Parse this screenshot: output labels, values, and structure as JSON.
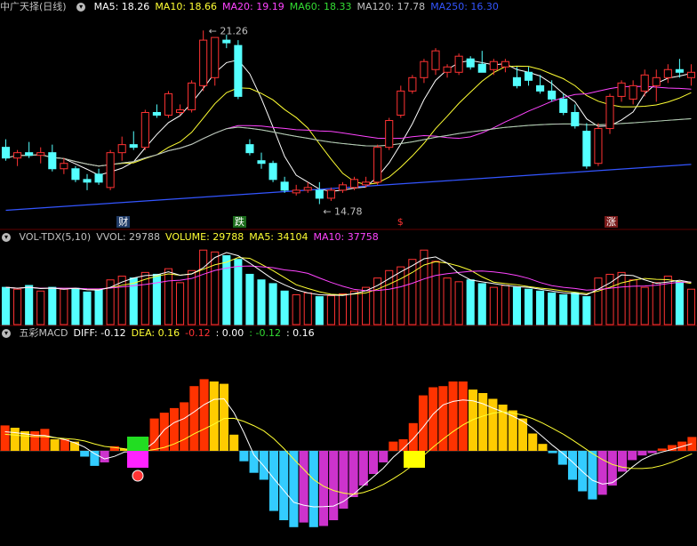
{
  "main_panel": {
    "title": "中广天择(日线)",
    "ma": [
      {
        "label": "MA5: 18.26",
        "color": "#ffffff"
      },
      {
        "label": "MA10: 18.66",
        "color": "#ffff33"
      },
      {
        "label": "MA20: 19.19",
        "color": "#ff44ff"
      },
      {
        "label": "MA60: 18.33",
        "color": "#33dd33"
      },
      {
        "label": "MA120: 17.78",
        "color": "#c0c0c0"
      },
      {
        "label": "MA250: 16.30",
        "color": "#3355ff"
      }
    ],
    "high_label": "21.26",
    "low_label": "14.78",
    "markers": [
      {
        "text": "财",
        "color": "#ffffff",
        "bg": "#1f3a66"
      },
      {
        "text": "跌",
        "color": "#ffffff",
        "bg": "#1a6a1a"
      },
      {
        "text": "$",
        "color": "#ff3333",
        "bg": ""
      },
      {
        "text": "涨",
        "color": "#ffffff",
        "bg": "#7a1a1a"
      }
    ]
  },
  "vol_panel": {
    "items": [
      {
        "label": "VOL-TDX(5,10)",
        "color": "#c0c0c0"
      },
      {
        "label": "VVOL: 29788",
        "color": "#c0c0c0"
      },
      {
        "label": "VOLUME: 29788",
        "color": "#ffff33"
      },
      {
        "label": "MA5: 34104",
        "color": "#ffff33"
      },
      {
        "label": "MA10: 37758",
        "color": "#ff44ff"
      }
    ]
  },
  "macd_panel": {
    "items": [
      {
        "label": "五彩MACD",
        "color": "#c0c0c0"
      },
      {
        "label": "DIFF: -0.12",
        "color": "#ffffff"
      },
      {
        "label": "DEA: 0.16",
        "color": "#ffff33"
      },
      {
        "label": "-0.12",
        "color": "#ff3333"
      },
      {
        "label": ": 0.00",
        "color": "#ffffff"
      },
      {
        "label": ": -0.12",
        "color": "#33dd33"
      },
      {
        "label": ": 0.16",
        "color": "#ffffff"
      }
    ]
  },
  "chart_data": {
    "type": "candlestick",
    "candles": [
      {
        "o": 16.9,
        "h": 17.2,
        "l": 16.4,
        "c": 16.5
      },
      {
        "o": 16.5,
        "h": 16.8,
        "l": 16.2,
        "c": 16.7
      },
      {
        "o": 16.7,
        "h": 17.1,
        "l": 16.5,
        "c": 16.6
      },
      {
        "o": 16.6,
        "h": 16.9,
        "l": 16.3,
        "c": 16.7
      },
      {
        "o": 16.7,
        "h": 17.0,
        "l": 16.0,
        "c": 16.1
      },
      {
        "o": 16.1,
        "h": 16.5,
        "l": 15.9,
        "c": 16.3
      },
      {
        "o": 16.1,
        "h": 16.2,
        "l": 15.6,
        "c": 15.7
      },
      {
        "o": 15.7,
        "h": 15.9,
        "l": 15.3,
        "c": 15.6
      },
      {
        "o": 15.9,
        "h": 16.1,
        "l": 15.5,
        "c": 15.6
      },
      {
        "o": 15.4,
        "h": 16.8,
        "l": 15.3,
        "c": 16.7
      },
      {
        "o": 16.7,
        "h": 17.3,
        "l": 16.4,
        "c": 17.0
      },
      {
        "o": 17.0,
        "h": 17.5,
        "l": 16.8,
        "c": 16.9
      },
      {
        "o": 16.9,
        "h": 18.3,
        "l": 16.8,
        "c": 18.2
      },
      {
        "o": 18.2,
        "h": 18.5,
        "l": 18.0,
        "c": 18.1
      },
      {
        "o": 18.1,
        "h": 19.0,
        "l": 18.0,
        "c": 18.9
      },
      {
        "o": 18.2,
        "h": 18.5,
        "l": 18.1,
        "c": 18.3
      },
      {
        "o": 18.3,
        "h": 19.4,
        "l": 18.2,
        "c": 19.3
      },
      {
        "o": 19.2,
        "h": 21.26,
        "l": 19.0,
        "c": 20.9
      },
      {
        "o": 19.5,
        "h": 21.0,
        "l": 19.2,
        "c": 21.0
      },
      {
        "o": 20.9,
        "h": 21.1,
        "l": 20.6,
        "c": 20.8
      },
      {
        "o": 20.7,
        "h": 20.9,
        "l": 18.7,
        "c": 18.8
      },
      {
        "o": 17.0,
        "h": 17.2,
        "l": 16.6,
        "c": 16.7
      },
      {
        "o": 16.4,
        "h": 16.7,
        "l": 16.1,
        "c": 16.3
      },
      {
        "o": 16.3,
        "h": 16.4,
        "l": 15.6,
        "c": 15.7
      },
      {
        "o": 15.6,
        "h": 15.8,
        "l": 15.2,
        "c": 15.3
      },
      {
        "o": 15.2,
        "h": 15.5,
        "l": 15.1,
        "c": 15.3
      },
      {
        "o": 15.3,
        "h": 15.6,
        "l": 15.2,
        "c": 15.4
      },
      {
        "o": 15.3,
        "h": 15.6,
        "l": 14.78,
        "c": 15.0
      },
      {
        "o": 15.0,
        "h": 15.4,
        "l": 14.9,
        "c": 15.3
      },
      {
        "o": 15.3,
        "h": 15.6,
        "l": 15.2,
        "c": 15.5
      },
      {
        "o": 15.4,
        "h": 15.8,
        "l": 15.3,
        "c": 15.7
      },
      {
        "o": 15.5,
        "h": 15.8,
        "l": 15.4,
        "c": 15.6
      },
      {
        "o": 15.6,
        "h": 17.0,
        "l": 15.5,
        "c": 16.9
      },
      {
        "o": 16.9,
        "h": 18.0,
        "l": 16.8,
        "c": 17.9
      },
      {
        "o": 18.1,
        "h": 19.2,
        "l": 18.0,
        "c": 19.0
      },
      {
        "o": 19.0,
        "h": 19.6,
        "l": 18.9,
        "c": 19.5
      },
      {
        "o": 19.5,
        "h": 20.2,
        "l": 19.3,
        "c": 20.1
      },
      {
        "o": 19.8,
        "h": 20.6,
        "l": 19.6,
        "c": 20.5
      },
      {
        "o": 19.7,
        "h": 20.0,
        "l": 19.5,
        "c": 19.9
      },
      {
        "o": 19.7,
        "h": 20.4,
        "l": 19.6,
        "c": 20.3
      },
      {
        "o": 20.2,
        "h": 20.3,
        "l": 19.8,
        "c": 19.9
      },
      {
        "o": 20.0,
        "h": 20.5,
        "l": 19.8,
        "c": 19.7
      },
      {
        "o": 19.8,
        "h": 20.2,
        "l": 19.6,
        "c": 20.1
      },
      {
        "o": 19.9,
        "h": 20.2,
        "l": 19.7,
        "c": 20.1
      },
      {
        "o": 19.5,
        "h": 19.9,
        "l": 19.1,
        "c": 19.2
      },
      {
        "o": 19.7,
        "h": 19.9,
        "l": 19.2,
        "c": 19.4
      },
      {
        "o": 19.2,
        "h": 19.6,
        "l": 18.9,
        "c": 19.0
      },
      {
        "o": 19.0,
        "h": 19.4,
        "l": 18.6,
        "c": 18.7
      },
      {
        "o": 18.7,
        "h": 18.9,
        "l": 18.1,
        "c": 18.2
      },
      {
        "o": 18.2,
        "h": 18.5,
        "l": 17.6,
        "c": 17.7
      },
      {
        "o": 17.5,
        "h": 17.8,
        "l": 16.1,
        "c": 16.2
      },
      {
        "o": 16.3,
        "h": 17.8,
        "l": 16.2,
        "c": 17.6
      },
      {
        "o": 17.6,
        "h": 18.9,
        "l": 17.4,
        "c": 18.8
      },
      {
        "o": 18.8,
        "h": 19.4,
        "l": 18.6,
        "c": 19.3
      },
      {
        "o": 18.7,
        "h": 19.4,
        "l": 18.5,
        "c": 19.2
      },
      {
        "o": 19.0,
        "h": 19.8,
        "l": 18.8,
        "c": 19.6
      },
      {
        "o": 19.2,
        "h": 19.8,
        "l": 18.6,
        "c": 19.5
      },
      {
        "o": 19.5,
        "h": 20.0,
        "l": 19.3,
        "c": 19.8
      },
      {
        "o": 19.8,
        "h": 20.2,
        "l": 19.5,
        "c": 19.7
      },
      {
        "o": 19.5,
        "h": 20.0,
        "l": 19.2,
        "c": 19.7
      }
    ],
    "volumes": [
      40,
      38,
      42,
      36,
      40,
      38,
      39,
      35,
      37,
      48,
      52,
      50,
      56,
      54,
      60,
      45,
      58,
      80,
      78,
      74,
      70,
      54,
      48,
      44,
      36,
      32,
      34,
      30,
      31,
      33,
      36,
      40,
      50,
      58,
      62,
      70,
      80,
      68,
      50,
      46,
      48,
      44,
      40,
      42,
      40,
      38,
      36,
      34,
      32,
      34,
      30,
      50,
      54,
      56,
      48,
      40,
      45,
      52,
      46,
      38
    ],
    "macd": [
      0.22,
      0.2,
      0.17,
      0.17,
      0.19,
      0.1,
      0.1,
      0.08,
      -0.05,
      -0.13,
      -0.1,
      0.04,
      0.02,
      -0.1,
      0.12,
      0.28,
      0.33,
      0.37,
      0.42,
      0.56,
      0.62,
      0.6,
      0.58,
      0.14,
      -0.09,
      -0.19,
      -0.25,
      -0.52,
      -0.6,
      -0.66,
      -0.62,
      -0.66,
      -0.65,
      -0.6,
      -0.5,
      -0.4,
      -0.3,
      -0.2,
      -0.1,
      0.08,
      0.1,
      0.24,
      0.48,
      0.55,
      0.56,
      0.6,
      0.6,
      0.53,
      0.5,
      0.45,
      0.4,
      0.35,
      0.28,
      0.15,
      0.06,
      -0.02,
      -0.12,
      -0.25,
      -0.35,
      -0.42,
      -0.38,
      -0.3,
      -0.18,
      -0.08,
      -0.04,
      -0.02,
      0.02,
      0.05,
      0.08,
      0.12
    ]
  }
}
